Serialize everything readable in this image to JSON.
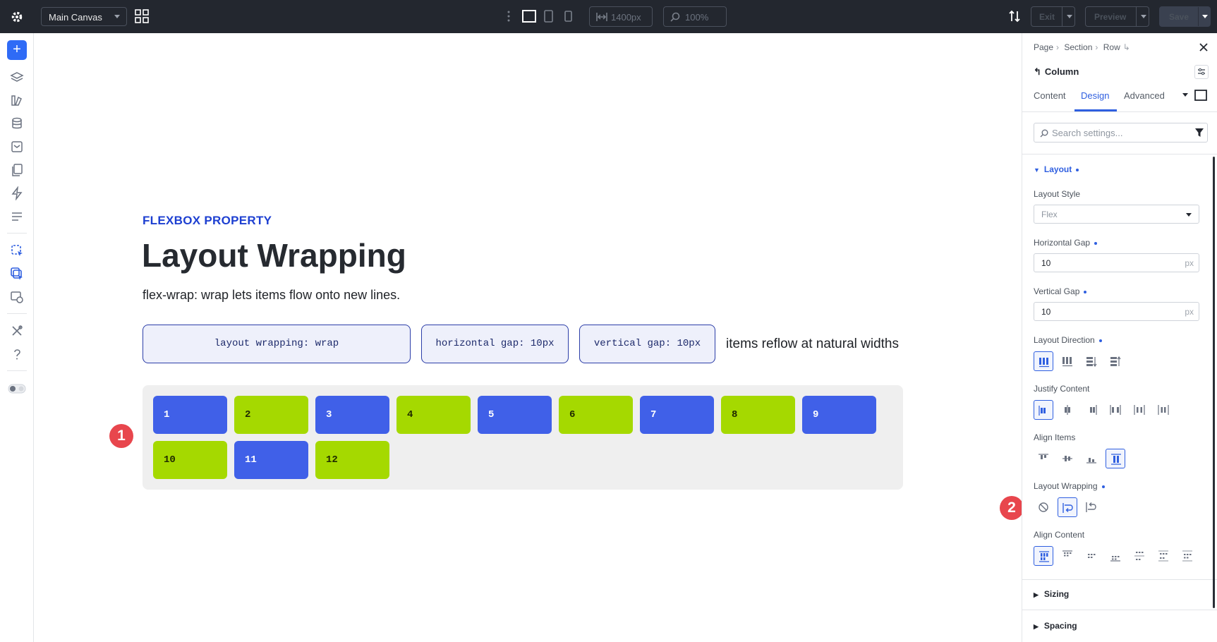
{
  "topbar": {
    "canvas_select": "Main Canvas",
    "width_value": "1400px",
    "zoom_value": "100%",
    "exit_label": "Exit",
    "preview_label": "Preview",
    "save_label": "Save"
  },
  "canvas": {
    "eyebrow": "FLEXBOX PROPERTY",
    "headline": "Layout Wrapping",
    "subline": "flex-wrap: wrap lets items flow onto new lines.",
    "chips": [
      "layout wrapping: wrap",
      "horizontal gap: 10px",
      "vertical gap: 10px"
    ],
    "reflow_note": "items reflow at natural widths",
    "items": [
      "1",
      "2",
      "3",
      "4",
      "5",
      "6",
      "7",
      "8",
      "9",
      "10",
      "11",
      "12"
    ],
    "marker_1": "1",
    "marker_2": "2"
  },
  "panel": {
    "breadcrumb": [
      "Page",
      "Section",
      "Row"
    ],
    "element_title": "Column",
    "tabs": [
      "Content",
      "Design",
      "Advanced"
    ],
    "active_tab": "Design",
    "search_placeholder": "Search settings...",
    "section_layout": "Layout",
    "layout_style_label": "Layout Style",
    "layout_style_value": "Flex",
    "hgap_label": "Horizontal Gap",
    "hgap_value": "10",
    "vgap_label": "Vertical Gap",
    "vgap_value": "10",
    "unit": "px",
    "direction_label": "Layout Direction",
    "justify_label": "Justify Content",
    "align_items_label": "Align Items",
    "wrapping_label": "Layout Wrapping",
    "align_content_label": "Align Content",
    "section_sizing": "Sizing",
    "section_spacing": "Spacing"
  },
  "colors": {
    "accent": "#2f5fe0",
    "item_blue": "#4060e8",
    "item_green": "#a5d900",
    "marker_red": "#e8464d",
    "topbar_bg": "#23272f"
  }
}
